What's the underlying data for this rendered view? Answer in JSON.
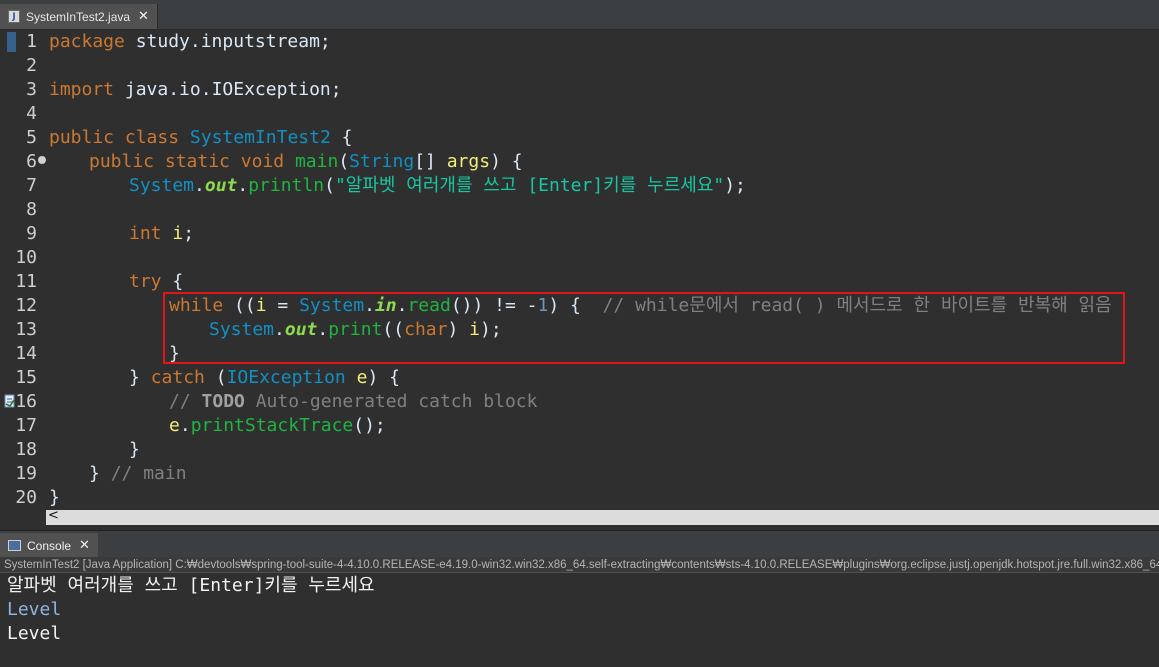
{
  "editor_tab": {
    "icon": "java-file-icon",
    "title": "SystemInTest2.java",
    "close": "✕"
  },
  "code": {
    "l1": {
      "n": "1",
      "kw": "package",
      "rest": " study.inputstream;"
    },
    "l2": {
      "n": "2"
    },
    "l3": {
      "n": "3",
      "kw": "import",
      "rest": " java.io.IOException;"
    },
    "l4": {
      "n": "4"
    },
    "l5": {
      "n": "5",
      "kw1": "public",
      "kw2": "class",
      "cls": "SystemInTest2",
      "rest": " {"
    },
    "l6": {
      "n": "6",
      "kw1": "public",
      "kw2": "static",
      "kw3": "void",
      "fn": "main",
      "p1": "(",
      "type": "String",
      "p2": "[] ",
      "var": "args",
      "p3": ") {"
    },
    "l7": {
      "n": "7",
      "type": "System",
      "dot1": ".",
      "fld": "out",
      "dot2": ".",
      "fn": "println",
      "p1": "(",
      "str": "\"알파벳 여러개를 쓰고 [Enter]키를 누르세요\"",
      "p2": ");"
    },
    "l8": {
      "n": "8"
    },
    "l9": {
      "n": "9",
      "kw": "int",
      "sp": " ",
      "var": "i",
      "p": ";"
    },
    "l10": {
      "n": "10"
    },
    "l11": {
      "n": "11",
      "kw": "try",
      "p": " {"
    },
    "l12": {
      "n": "12",
      "kw": "while",
      "p1": " ((",
      "var": "i",
      "p2": " = ",
      "type": "System",
      "dot1": ".",
      "fld": "in",
      "dot2": ".",
      "fn": "read",
      "p3": "()) != -",
      "num": "1",
      "p4": ") {  ",
      "cm": "// while문에서 read( ) 메서드로 한 바이트를 반복해 읽음"
    },
    "l13": {
      "n": "13",
      "type": "System",
      "dot1": ".",
      "fld": "out",
      "dot2": ".",
      "fn": "print",
      "p1": "((",
      "kw": "char",
      "p2": ") ",
      "var": "i",
      "p3": ");"
    },
    "l14": {
      "n": "14",
      "p": "}"
    },
    "l15": {
      "n": "15",
      "p1": "} ",
      "kw": "catch",
      "p2": " (",
      "type": "IOException",
      "sp": " ",
      "var": "e",
      "p3": ") {"
    },
    "l16": {
      "n": "16",
      "cm1": "// ",
      "todo": "TODO",
      "cm2": " Auto-generated catch block"
    },
    "l17": {
      "n": "17",
      "var": "e",
      "p1": ".",
      "fn": "printStackTrace",
      "p2": "();"
    },
    "l18": {
      "n": "18",
      "p": "}"
    },
    "l19": {
      "n": "19",
      "p": "} ",
      "cm": "// main"
    },
    "l20": {
      "n": "20",
      "p": "}"
    }
  },
  "scroll": {
    "left_arrow": "<"
  },
  "console": {
    "tab_title": "Console",
    "close": "✕",
    "header": "SystemInTest2 [Java Application] C:₩devtools₩spring-tool-suite-4-4.10.0.RELEASE-e4.19.0-win32.win32.x86_64.self-extracting₩contents₩sts-4.10.0.RELEASE₩plugins₩org.eclipse.justj.openjdk.hotspot.jre.full.win32.x86_64",
    "lines": [
      "알파벳 여러개를 쓰고 [Enter]키를 누르세요",
      "Level",
      "Level"
    ]
  },
  "colors": {
    "keyword": "#cc7832",
    "highlight_box": "#e0141b",
    "background": "#2f2f2f"
  }
}
